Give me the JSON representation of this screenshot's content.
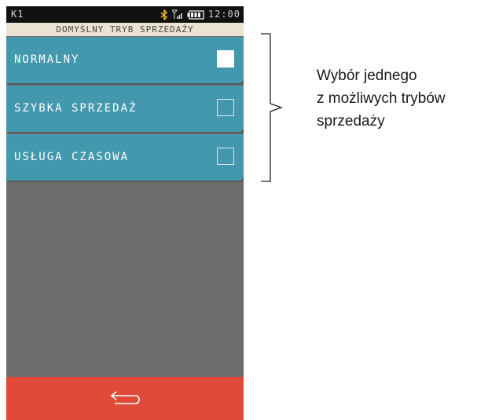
{
  "status_bar": {
    "left_label": "K1",
    "clock": "12:00",
    "icons": [
      "bluetooth-icon",
      "signal-icon",
      "battery-icon"
    ],
    "bluetooth_color": "#f5c518"
  },
  "screen": {
    "title": "DOMYŚLNY TRYB SPRZEDAŻY",
    "options": [
      {
        "label": "NORMALNY",
        "checked": true
      },
      {
        "label": "SZYBKA SPRZEDAŻ",
        "checked": false
      },
      {
        "label": "USŁUGA CZASOWA",
        "checked": false
      }
    ],
    "back_icon": "back-arrow-icon"
  },
  "annotation": {
    "text": "Wybór jednego\nz możliwych trybów\nsprzedaży"
  },
  "colors": {
    "option_bg": "#4398ad",
    "screen_bg": "#6d6d6d",
    "header_bg": "#eae3d2",
    "back_bar": "#e04a39",
    "status_bar": "#111111"
  }
}
